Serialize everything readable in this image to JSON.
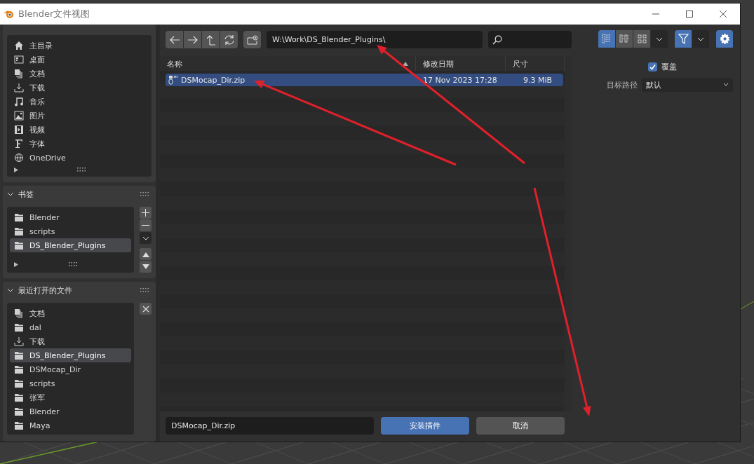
{
  "window": {
    "title": "Blender文件视图"
  },
  "system_places": [
    {
      "label": "主目录",
      "kind": "home"
    },
    {
      "label": "桌面",
      "kind": "desktop"
    },
    {
      "label": "文档",
      "kind": "documents"
    },
    {
      "label": "下载",
      "kind": "download"
    },
    {
      "label": "音乐",
      "kind": "music"
    },
    {
      "label": "图片",
      "kind": "picture"
    },
    {
      "label": "视频",
      "kind": "video"
    },
    {
      "label": "字体",
      "kind": "font"
    },
    {
      "label": "OneDrive",
      "kind": "network"
    }
  ],
  "bookmarks": {
    "title": "书签",
    "expanded": true,
    "items": [
      {
        "label": "Blender",
        "kind": "folder",
        "selected": false
      },
      {
        "label": "scripts",
        "kind": "folder",
        "selected": false
      },
      {
        "label": "DS_Blender_Plugins",
        "kind": "folder",
        "selected": true
      }
    ]
  },
  "recent": {
    "title": "最近打开的文件",
    "expanded": true,
    "items": [
      {
        "label": "文档",
        "kind": "documents",
        "selected": false
      },
      {
        "label": "dal",
        "kind": "folder",
        "selected": false
      },
      {
        "label": "下载",
        "kind": "download",
        "selected": false
      },
      {
        "label": "DS_Blender_Plugins",
        "kind": "folder",
        "selected": true
      },
      {
        "label": "DSMocap_Dir",
        "kind": "folder",
        "selected": false
      },
      {
        "label": "scripts",
        "kind": "folder",
        "selected": false
      },
      {
        "label": "张军",
        "kind": "folder",
        "selected": false
      },
      {
        "label": "Blender",
        "kind": "folder",
        "selected": false
      },
      {
        "label": "Maya",
        "kind": "folder",
        "selected": false
      }
    ]
  },
  "path": "W:\\Work\\DS_Blender_Plugins\\",
  "view_modes": [
    {
      "kind": "vertical-list",
      "selected": true
    },
    {
      "kind": "horizontal-list",
      "selected": false
    },
    {
      "kind": "thumbnails",
      "selected": false
    }
  ],
  "filter": {
    "on": true
  },
  "table": {
    "columns": [
      {
        "label": "名称",
        "sorted": true
      },
      {
        "label": "修改日期",
        "sorted": false
      },
      {
        "label": "尺寸",
        "sorted": false
      }
    ],
    "rows": [
      {
        "name": "DSMocap_Dir.zip",
        "date": "17 Nov 2023 17:28",
        "size": "9.3 MiB",
        "selected": true
      }
    ]
  },
  "options": {
    "overwrite": {
      "label": "覆盖",
      "checked": true
    },
    "target_path": {
      "label": "目标路径",
      "value": "默认"
    }
  },
  "filename": "DSMocap_Dir.zip",
  "buttons": [
    {
      "label": "安装插件",
      "kind": "primary"
    },
    {
      "label": "取消",
      "kind": "secondary"
    }
  ]
}
